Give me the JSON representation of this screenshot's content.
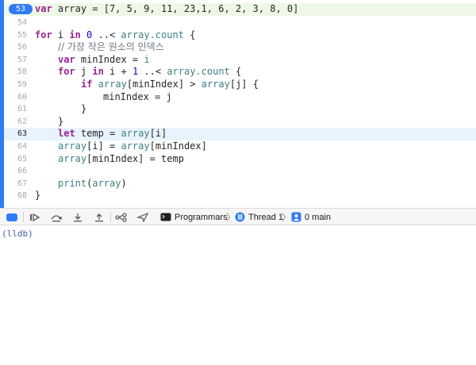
{
  "editor": {
    "lines": [
      {
        "num": "53",
        "current_badge": true
      },
      {
        "num": "54"
      },
      {
        "num": "55"
      },
      {
        "num": "56"
      },
      {
        "num": "57"
      },
      {
        "num": "58"
      },
      {
        "num": "59"
      },
      {
        "num": "60"
      },
      {
        "num": "61"
      },
      {
        "num": "62"
      },
      {
        "num": "63",
        "current": true
      },
      {
        "num": "64"
      },
      {
        "num": "65"
      },
      {
        "num": "66"
      },
      {
        "num": "67"
      },
      {
        "num": "68"
      }
    ],
    "code": {
      "l53": {
        "kw": "var",
        "name": "array",
        "rest": " = [7, 5, 9, 11, 23,1, 6, 2, 3, 8, 0]"
      },
      "l55": {
        "kw": "for",
        "a": " i ",
        "kw2": "in",
        "num": " 0 ",
        "b": "..< ",
        "fn": "array.count",
        "c": " {"
      },
      "l56": {
        "comment": "// 가장 작은 원소의 인덱스"
      },
      "l57": {
        "kw": "var",
        "a": " minIndex = ",
        "fn": "i"
      },
      "l58": {
        "kw": "for",
        "a": " j ",
        "kw2": "in",
        "b": " i + ",
        "num": "1",
        "c": " ..< ",
        "fn": "array.count",
        "d": " {"
      },
      "l59": {
        "kw": "if",
        "fn1": " array",
        "a": "[minIndex] > ",
        "fn2": "array",
        "b": "[j] {"
      },
      "l60": {
        "text": "minIndex = j"
      },
      "l61": {
        "text": "}"
      },
      "l62": {
        "text": "}"
      },
      "l63": {
        "kw": "let",
        "a": " temp = ",
        "fn": "array",
        "b": "[i]"
      },
      "l64": {
        "fn1": "array",
        "a": "[i] = ",
        "fn2": "array",
        "b": "[minIndex]"
      },
      "l65": {
        "fn1": "array",
        "a": "[minIndex] = temp"
      },
      "l67": {
        "fn": "print",
        "a": "(",
        "fn2": "array",
        "b": ")"
      },
      "l68": {
        "text": "}"
      }
    }
  },
  "debug_bar": {
    "target": "Programmars",
    "thread": "Thread 1",
    "frame": "0 main"
  },
  "console": {
    "prompt": "(lldb)"
  },
  "colors": {
    "accent": "#2f7cf6",
    "keyword": "#9b2393",
    "number": "#1c00cf",
    "line_highlight": "#e9f3fd"
  }
}
